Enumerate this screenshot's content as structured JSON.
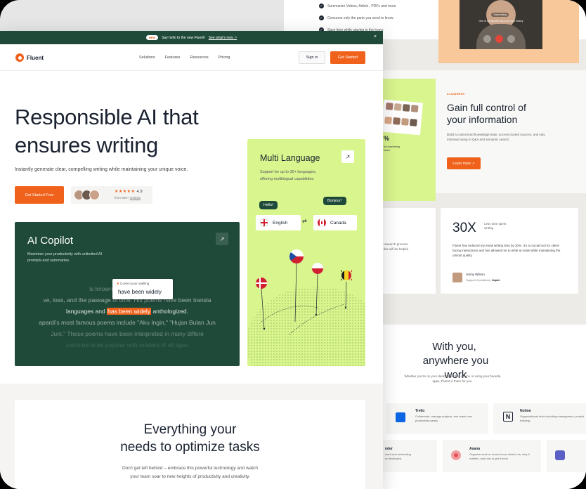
{
  "banner": {
    "badge": "NEW",
    "message": "Say hello to the new Fluent!",
    "link": "See what's new ↗"
  },
  "nav": {
    "brand": "Fluent",
    "items": [
      "Solutions",
      "Features",
      "Resources",
      "Pricing"
    ],
    "signin": "Sign in",
    "cta": "Get Started"
  },
  "hero": {
    "title_line1": "Responsible AI that",
    "title_line2": "ensures writing",
    "subtitle": "Instantly generate clear, compelling writing while maintaining your unique voice.",
    "cta": "Get Started Free",
    "rating_value": "4.9",
    "rating_stars": "★★★★★",
    "rating_from": "from 600+",
    "rating_link": "reviews"
  },
  "copilot": {
    "title": "AI Copilot",
    "desc_line1": "Maximize your productivity with unlimited AI",
    "desc_line2": "prompts and summaries.",
    "line1": "is known for its sim          gery, whi",
    "line2": "ve, loss, and the passage of time. His poems have been transla",
    "line3_pre": "languages and ",
    "line3_hl": "has been widely",
    "line3_post": " anthologized.",
    "line4": "apardi's most famous poems include \"Aku Ingin,\" \"Hujan Bulan Jun",
    "line5": "Juni.\" These poems have been interpreted in many differe",
    "line6": "continue to be popular with readers of all ages",
    "popup_label": "Correct your spelling",
    "popup_text": "have been widely"
  },
  "multilang": {
    "title": "Multi Language",
    "desc_line1": "Support for up to 30+ languages,",
    "desc_line2": "offering multilingual capabilities.",
    "hello": "Hello!",
    "bonjour": "Bonjour!",
    "lang_left": "English",
    "lang_right": "Canada",
    "swap": "⇄"
  },
  "bottom": {
    "title_line1": "Everything your",
    "title_line2": "needs to optimize tasks",
    "desc_line1": "Don't get left behind – embrace this powerful technology and watch",
    "desc_line2": "your team soar to new heights of productivity and creativity."
  },
  "back": {
    "checks": [
      "Summarize Videos, Article , PDFs and more",
      "Consume only the parts you need to know.",
      "Save time while staying in the know."
    ],
    "video_caption": "One of my favorite has to be your history",
    "video_label": "Transcribing",
    "ai_tag": "AI ANSWERS",
    "control_title_line1": "Gain full control of",
    "control_title_line2": "your information",
    "control_desc": "Build a customized knowledge base, access trusted sources, and stay informed using AI Q&A and semantic search.",
    "learn_more": "Learn more",
    "percent": "%",
    "percent_caption": "ed marketing\nteam",
    "stat_value": "30X",
    "stat_label": "Less time spent writing",
    "stat_left_text": "research process\nlles will be helpful",
    "testimonial": "Fluent has reduced my email writing time by 30%. It's a crucial tool for client-facing interactions and has allowed me to write at scale while maintaining the utmost quality.",
    "person_name": "Jenny Wilson",
    "person_role": "Support Operations,",
    "person_company": "Zapier",
    "with_line1": "With you,",
    "with_line2": "anywhere you work",
    "with_desc": "Whether you're on your desktop, mobile device or using your favorite apps, Fluent is there for you.",
    "apps": [
      {
        "name": "Trello",
        "desc": "Collaborate, manage projects, and reach new productivity peaks."
      },
      {
        "name": "Notion",
        "desc": "Organizational tools including management, project tracking,"
      },
      {
        "name": "nder",
        "desc": "ment and scheduling\nre developed."
      },
      {
        "name": "Asana",
        "desc": "Organize work so teams know what to do, why it matters, and how to get it done."
      }
    ]
  },
  "colors": {
    "brand_green": "#1f4a3a",
    "accent_orange": "#f0621b",
    "lime": "#d9f58e",
    "peach": "#f8c89a"
  }
}
